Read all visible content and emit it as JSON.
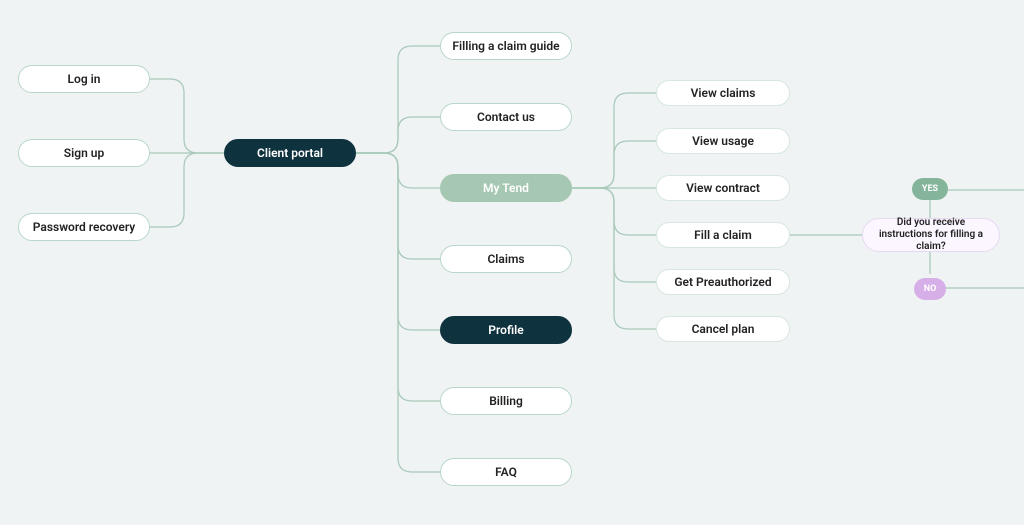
{
  "col1": {
    "login": "Log in",
    "signup": "Sign up",
    "recovery": "Password recovery"
  },
  "hub": "Client portal",
  "col3": {
    "guide": "Filling a claim guide",
    "contact": "Contact us",
    "mytend": "My Tend",
    "claims": "Claims",
    "profile": "Profile",
    "billing": "Billing",
    "faq": "FAQ"
  },
  "col4": {
    "view_claims": "View claims",
    "view_usage": "View usage",
    "view_contract": "View contract",
    "fill_claim": "Fill a claim",
    "preauth": "Get Preauthorized",
    "cancel": "Cancel plan"
  },
  "decision": {
    "question": "Did you receive instructions for filling a claim?",
    "yes": "YES",
    "no": "NO"
  }
}
